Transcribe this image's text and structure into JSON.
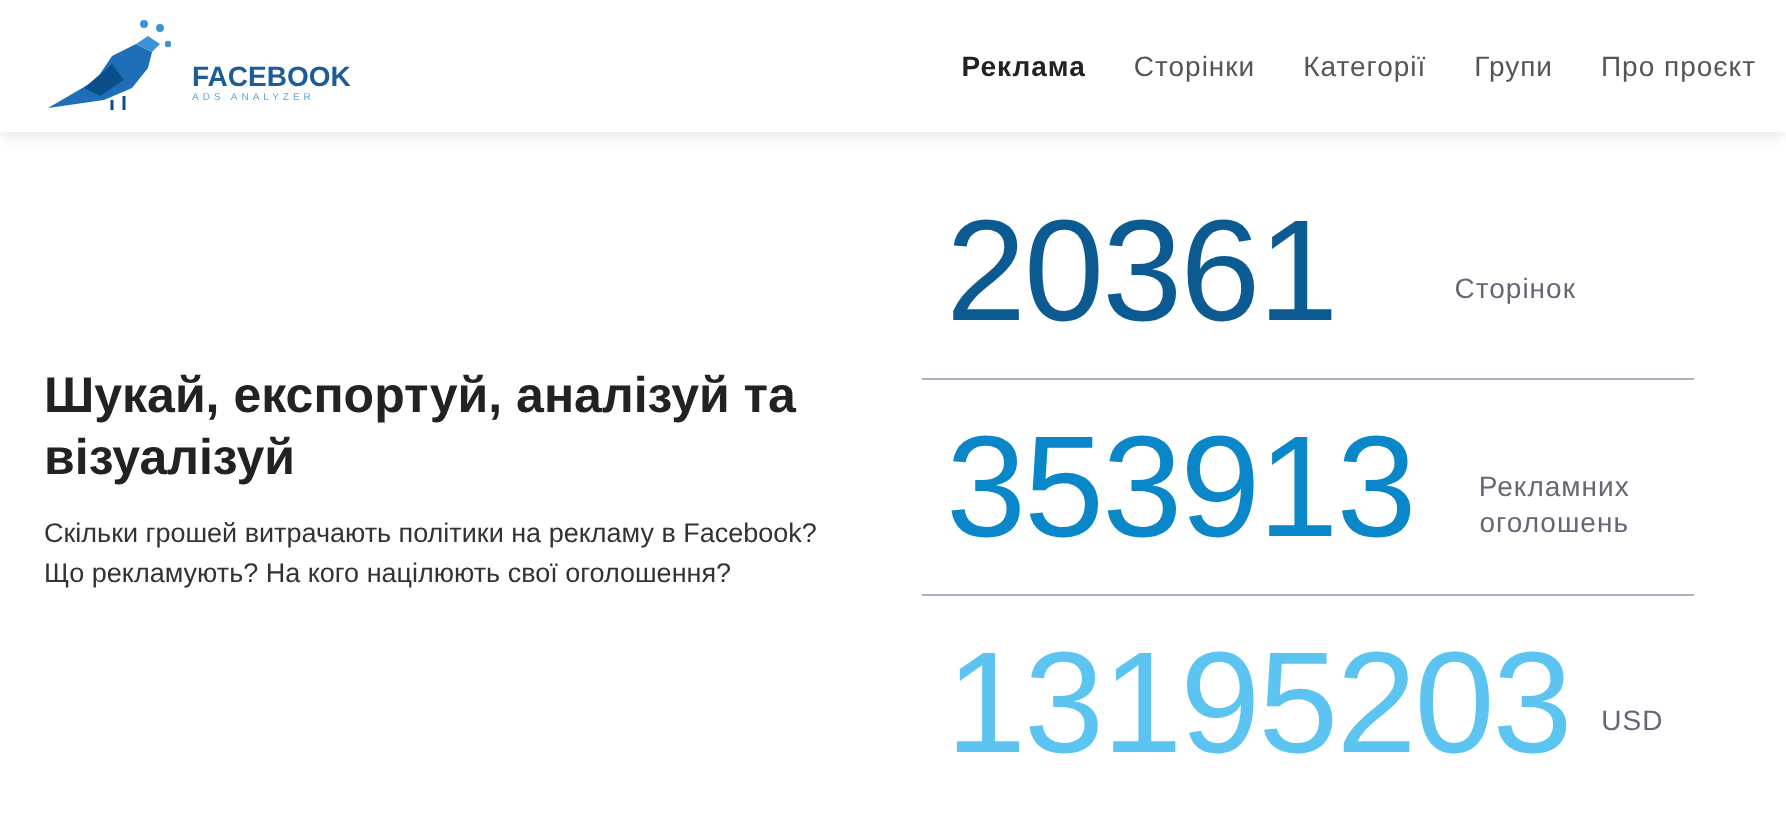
{
  "logo": {
    "title": "FACEBOOK",
    "subtitle": "ADS ANALYZER"
  },
  "nav": [
    {
      "label": "Реклама",
      "selected": true
    },
    {
      "label": "Сторінки",
      "selected": false
    },
    {
      "label": "Категорії",
      "selected": false
    },
    {
      "label": "Групи",
      "selected": false
    },
    {
      "label": "Про проєкт",
      "selected": false
    }
  ],
  "hero": {
    "heading": "Шукай, експортуй, аналізуй та візуалізуй",
    "text": "Скільки грошей витрачають політики на рекламу в Facebook? Що рекламують? На кого націлюють свої оголошення?"
  },
  "stats": [
    {
      "value": "20361",
      "label": "Сторінок",
      "color": "#0b5a92"
    },
    {
      "value": "353913",
      "label": "Рекламних оголошень",
      "color": "#0a87c8"
    },
    {
      "value": "13195203",
      "label": "USD",
      "color": "#5cc4f0"
    }
  ]
}
